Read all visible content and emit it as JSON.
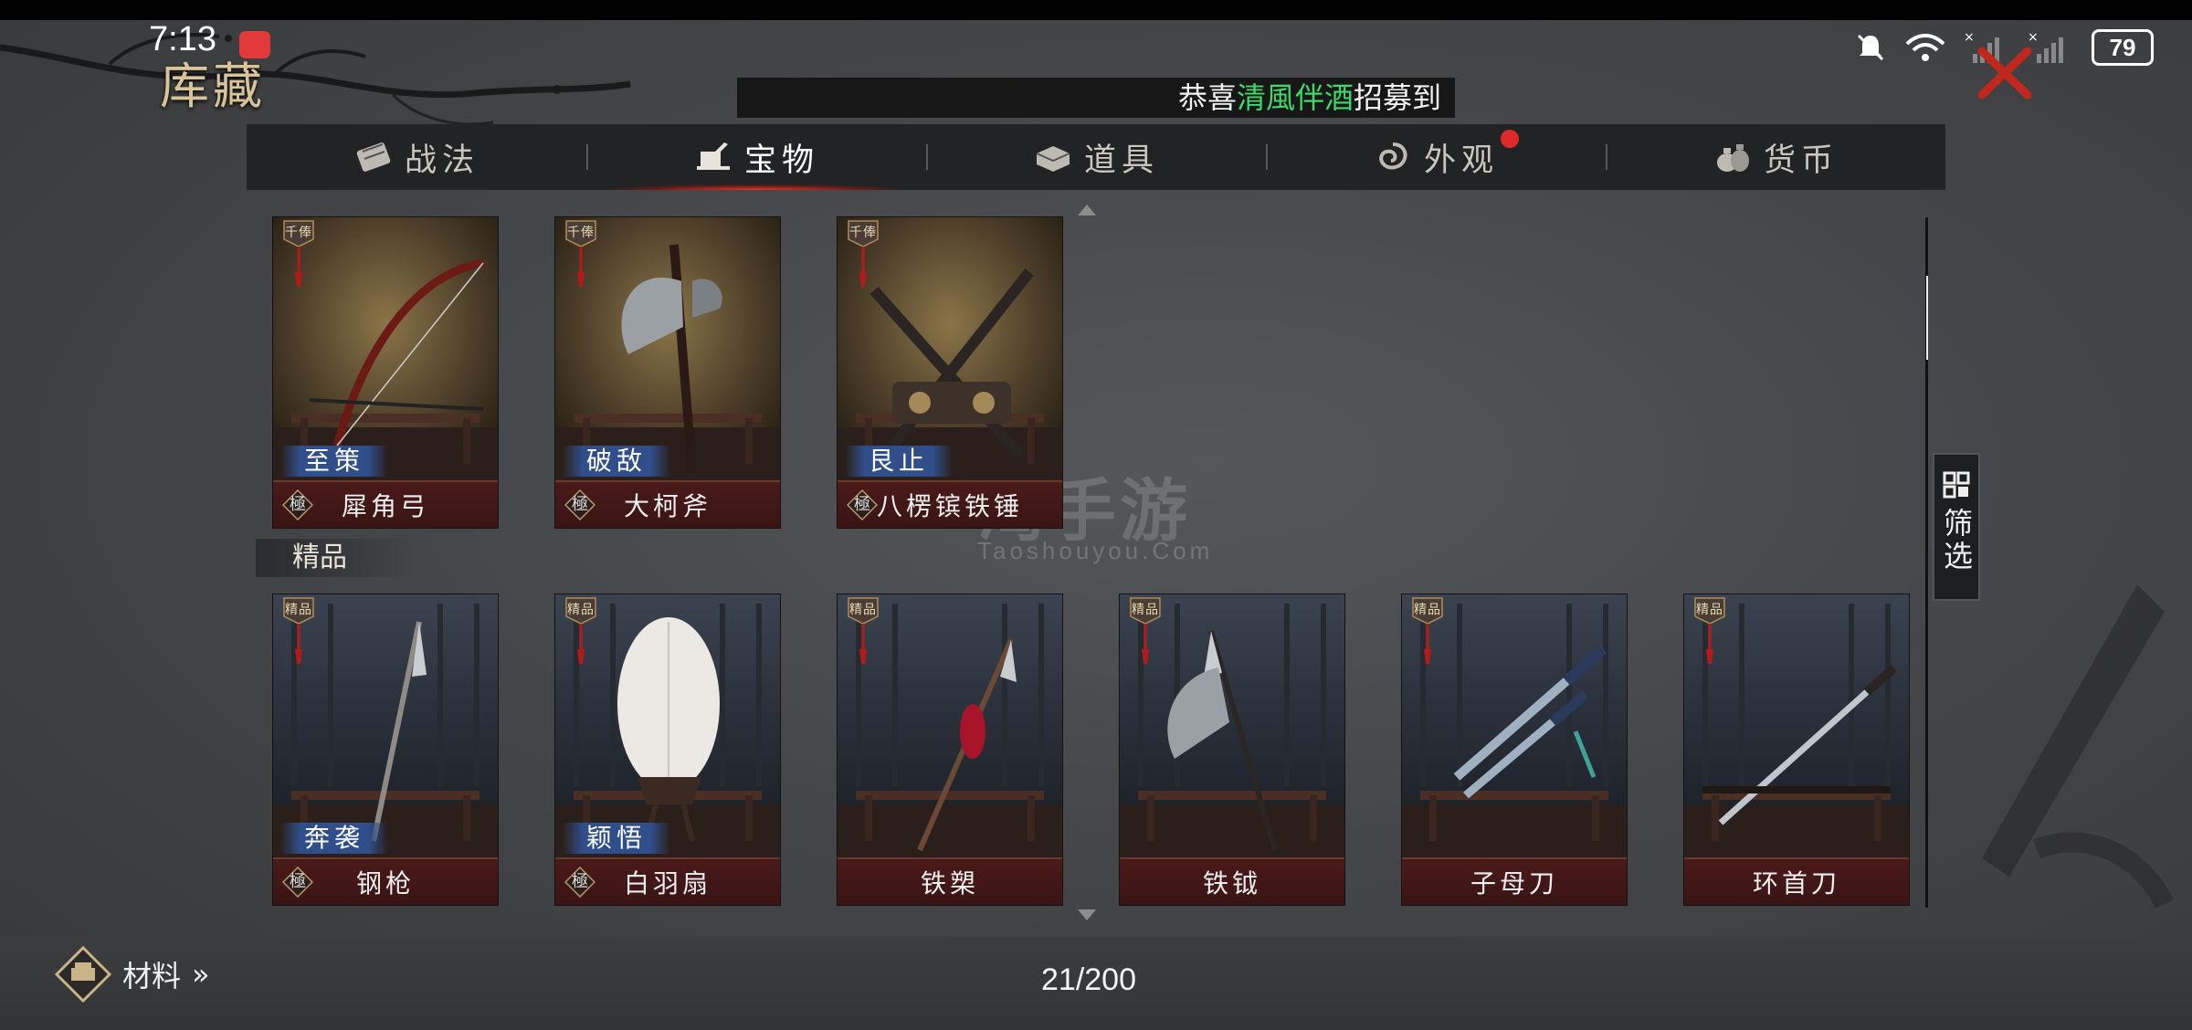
{
  "status_bar": {
    "time": "7:13",
    "battery": "79"
  },
  "header": {
    "title": "库藏"
  },
  "ticker": {
    "prefix": "恭喜",
    "name": "清風伴酒",
    "suffix": "招募到"
  },
  "tabs": [
    {
      "label": "战法",
      "icon": "scroll-icon",
      "active": false
    },
    {
      "label": "宝物",
      "icon": "treasure-icon",
      "active": true
    },
    {
      "label": "道具",
      "icon": "box-icon",
      "active": false
    },
    {
      "label": "外观",
      "icon": "swirl-icon",
      "active": false,
      "badge": true
    },
    {
      "label": "货币",
      "icon": "money-bag-icon",
      "active": false
    }
  ],
  "top_cards": [
    {
      "rank": "千俸",
      "skill": "至策",
      "grade": "極",
      "name": "犀角弓",
      "art": "bow"
    },
    {
      "rank": "千俸",
      "skill": "破敌",
      "grade": "極",
      "name": "大柯斧",
      "art": "axe"
    },
    {
      "rank": "千俸",
      "skill": "艮止",
      "grade": "極",
      "name": "八楞镔铁锤",
      "art": "hammer"
    }
  ],
  "section": {
    "label": "精品"
  },
  "quality_cards": [
    {
      "rank": "精品",
      "skill": "奔袭",
      "grade": "極",
      "name": "钢枪",
      "art": "spear"
    },
    {
      "rank": "精品",
      "skill": "颖悟",
      "grade": "極",
      "name": "白羽扇",
      "art": "fan"
    },
    {
      "rank": "精品",
      "skill": "",
      "grade": "",
      "name": "铁槊",
      "art": "lance"
    },
    {
      "rank": "精品",
      "skill": "",
      "grade": "",
      "name": "铁钺",
      "art": "halberd"
    },
    {
      "rank": "精品",
      "skill": "",
      "grade": "",
      "name": "子母刀",
      "art": "twin-sword"
    },
    {
      "rank": "精品",
      "skill": "",
      "grade": "",
      "name": "环首刀",
      "art": "sword"
    }
  ],
  "filter": {
    "label": "筛选"
  },
  "footer": {
    "materials_label": "材料",
    "materials_chevron": "»",
    "counter": "21/200"
  },
  "watermark": {
    "main": "淘手游",
    "sub": "Taoshouyou.Com"
  },
  "colors": {
    "accent_red": "#e23a2a",
    "ticker_name": "#3fd86a",
    "skill_blue": "#2f4e8a",
    "name_bar": "#3a1414"
  }
}
